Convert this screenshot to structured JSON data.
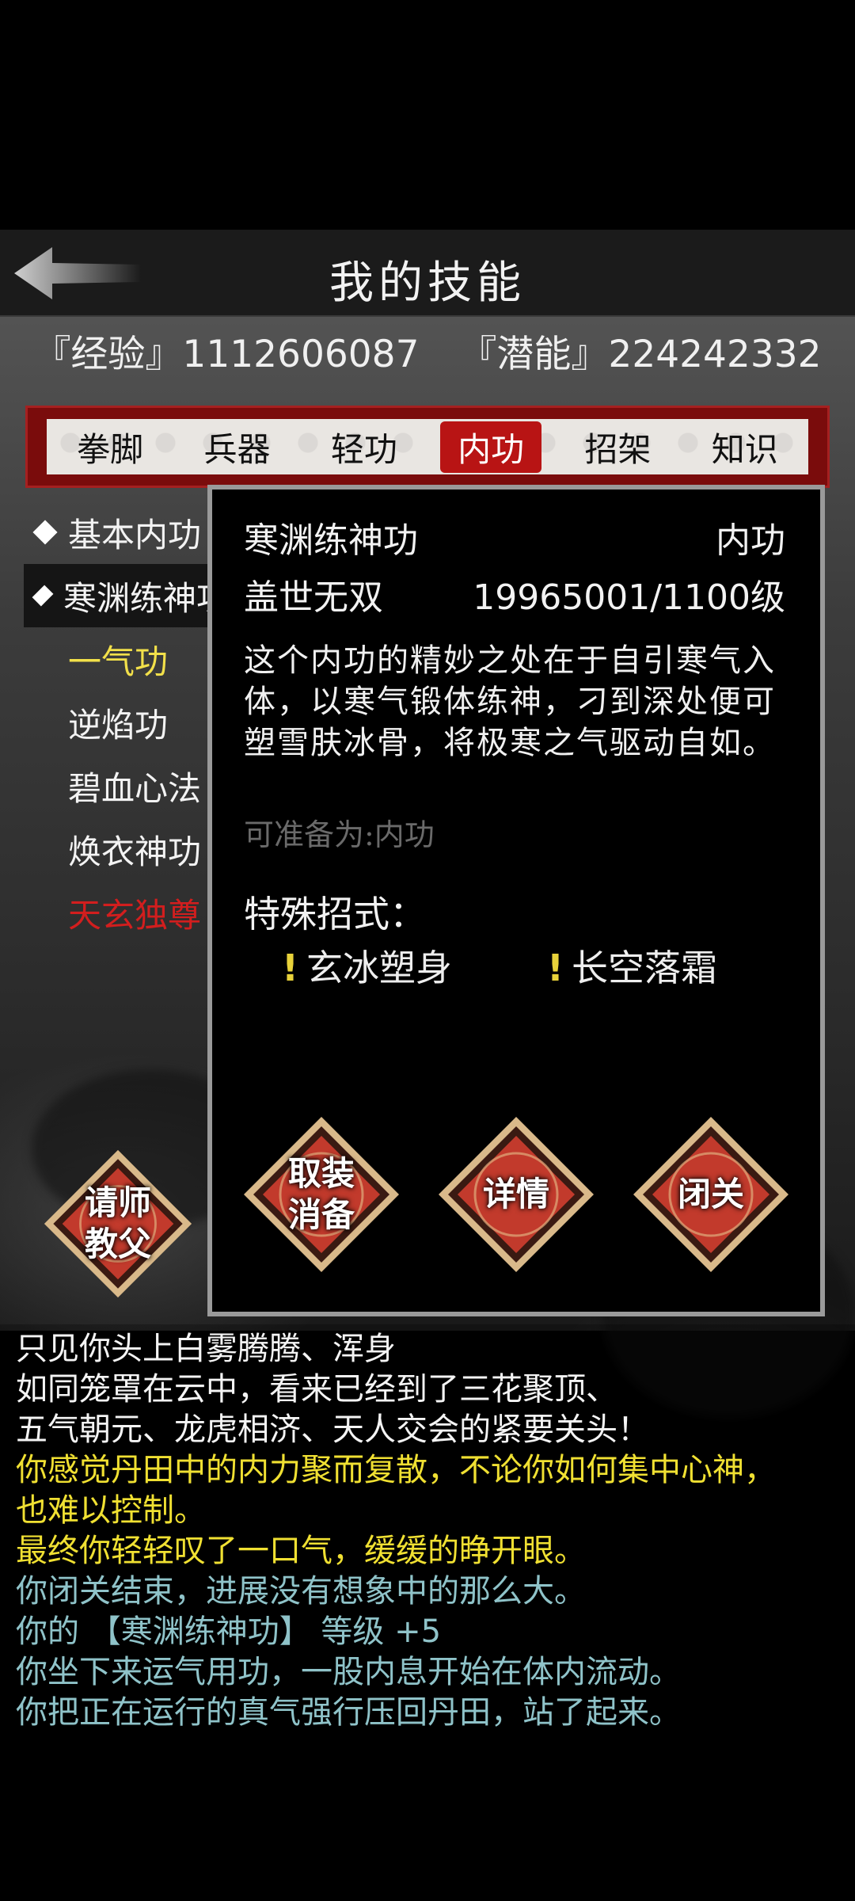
{
  "header": {
    "title": "我的技能"
  },
  "stats": {
    "exp": "『经验』1112606087",
    "potential": "『潜能』224242332"
  },
  "tabs": [
    "拳脚",
    "兵器",
    "轻功",
    "内功",
    "招架",
    "知识"
  ],
  "active_tab": "内功",
  "skill_list": {
    "items": [
      "基本内功",
      "寒渊练神功",
      "一气功",
      "逆焰功",
      "碧血心法",
      "焕衣神功",
      "天玄独尊"
    ]
  },
  "master_button": {
    "line1": "请师",
    "line2": "教父"
  },
  "dialog": {
    "skill_name": "寒渊练神功",
    "skill_type": "内功",
    "rank": "盖世无双",
    "level": "19965001/1100级",
    "description": "这个内功的精妙之处在于自引寒气入体，以寒气锻体练神，刁到深处便可塑雪肤冰骨，将极寒之气驱动自如。",
    "prepare": "可准备为:内功",
    "special_title": "特殊招式：",
    "moves": [
      "玄冰塑身",
      "长空落霜"
    ],
    "move_mark": "!",
    "buttons": {
      "unequip_line1": "取装",
      "unequip_line2": "消备",
      "details": "详情",
      "seclusion": "闭关"
    }
  },
  "log": [
    {
      "text": "只见你头上白雾腾腾、浑身",
      "color": "white"
    },
    {
      "text": "如同笼罩在云中，看来已经到了三花聚顶、",
      "color": "white"
    },
    {
      "text": "五气朝元、龙虎相济、天人交会的紧要关头！",
      "color": "white"
    },
    {
      "text": "你感觉丹田中的内力聚而复散，不论你如何集中心神，",
      "color": "yellow"
    },
    {
      "text": "也难以控制。",
      "color": "yellow"
    },
    {
      "text": "最终你轻轻叹了一口气，缓缓的睁开眼。",
      "color": "yellow"
    },
    {
      "text": "你闭关结束，进展没有想象中的那么大。",
      "color": "blue"
    },
    {
      "text": "你的 【寒渊练神功】 等级 +5",
      "color": "blue"
    },
    {
      "text": "你坐下来运气用功，一股内息开始在体内流动。",
      "color": "blue"
    },
    {
      "text": "你把正在运行的真气强行压回丹田，站了起来。",
      "color": "blue"
    }
  ]
}
